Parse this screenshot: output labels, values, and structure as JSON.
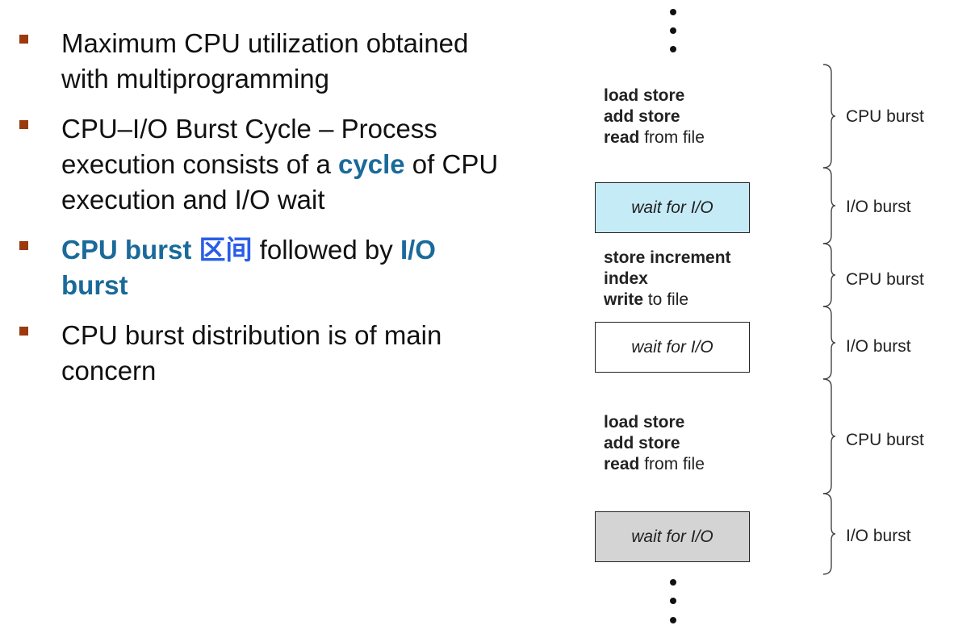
{
  "bullets": [
    {
      "segments": [
        {
          "text": "Maximum CPU utilization obtained with multiprogramming",
          "style": "normal"
        }
      ]
    },
    {
      "segments": [
        {
          "text": "CPU–I/O Burst Cycle – Process execution consists of a ",
          "style": "normal"
        },
        {
          "text": "cycle",
          "style": "blue-bold"
        },
        {
          "text": " of CPU execution and I/O wait",
          "style": "normal"
        }
      ]
    },
    {
      "segments": [
        {
          "text": "CPU burst ",
          "style": "blue-bold"
        },
        {
          "text": "区间",
          "style": "brightblue-bold"
        },
        {
          "text": " followed by ",
          "style": "normal"
        },
        {
          "text": "I/O burst",
          "style": "blue-bold"
        }
      ]
    },
    {
      "segments": [
        {
          "text": "CPU burst distribution is of main concern",
          "style": "normal"
        }
      ]
    }
  ],
  "diagram": {
    "code_blocks": [
      {
        "lines": [
          [
            {
              "text": "load store",
              "bold": true
            }
          ],
          [
            {
              "text": "add store",
              "bold": true
            }
          ],
          [
            {
              "text": "read",
              "bold": true
            },
            {
              "text": " from file",
              "bold": false
            }
          ]
        ]
      },
      {
        "lines": [
          [
            {
              "text": "store increment",
              "bold": true
            }
          ],
          [
            {
              "text": "index",
              "bold": true
            }
          ],
          [
            {
              "text": "write",
              "bold": true
            },
            {
              "text": " to file",
              "bold": false
            }
          ]
        ]
      },
      {
        "lines": [
          [
            {
              "text": "load store",
              "bold": true
            }
          ],
          [
            {
              "text": "add store",
              "bold": true
            }
          ],
          [
            {
              "text": "read",
              "bold": true
            },
            {
              "text": " from file",
              "bold": false
            }
          ]
        ]
      }
    ],
    "wait_boxes": [
      {
        "label": "wait for I/O",
        "fill": "#c5ebf7"
      },
      {
        "label": "wait for I/O",
        "fill": "#ffffff"
      },
      {
        "label": "wait for I/O",
        "fill": "#d4d4d4"
      }
    ],
    "burst_labels": [
      "CPU burst",
      "I/O burst",
      "CPU burst",
      "I/O burst",
      "CPU burst",
      "I/O burst"
    ]
  },
  "colors": {
    "bullet_marker": "#9a3a0e",
    "accent_blue": "#1a6a9a",
    "bright_blue": "#2a5de8"
  }
}
